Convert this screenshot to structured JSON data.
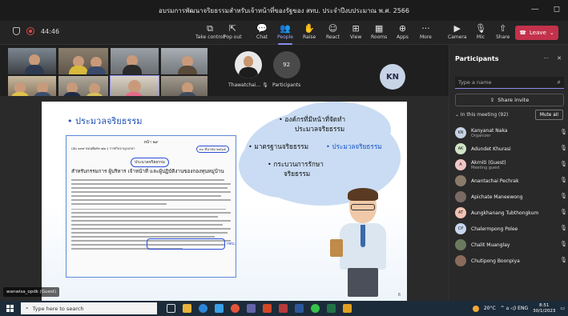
{
  "window": {
    "title": "อบรมการพัฒนาจริยธรรมสำหรับเจ้าหน้าที่ของรัฐของ สทบ. ประจำปีงบประมาณ พ.ศ. 2566",
    "minimize_glyph": "—",
    "restore_glyph": "◻"
  },
  "meeting": {
    "timer": "44:46",
    "toolbar": [
      {
        "id": "take-control",
        "label": "Take control",
        "glyph": "⧉"
      },
      {
        "id": "pop-out",
        "label": "Pop out",
        "glyph": "⇱"
      },
      {
        "id": "chat",
        "label": "Chat",
        "glyph": "💬"
      },
      {
        "id": "people",
        "label": "People",
        "glyph": "👥"
      },
      {
        "id": "raise",
        "label": "Raise",
        "glyph": "✋"
      },
      {
        "id": "react",
        "label": "React",
        "glyph": "☺"
      },
      {
        "id": "view",
        "label": "View",
        "glyph": "⊞"
      },
      {
        "id": "rooms",
        "label": "Rooms",
        "glyph": "▦"
      },
      {
        "id": "apps",
        "label": "Apps",
        "glyph": "⊕"
      },
      {
        "id": "more",
        "label": "More",
        "glyph": "···"
      },
      {
        "id": "camera",
        "label": "Camera",
        "glyph": "▶"
      },
      {
        "id": "mic",
        "label": "Mic",
        "glyph": "🎙"
      },
      {
        "id": "share",
        "label": "Share",
        "glyph": "⇧"
      }
    ],
    "leave_label": "Leave",
    "leave_glyph": "☎",
    "leave_chevron": "⌄"
  },
  "tiles": {
    "speaker_name": "Thawatchai...",
    "participants_count": "92",
    "participants_label": "Participants",
    "kn_initials": "KN"
  },
  "slide": {
    "title_bullet": "• ประมวลจริยธรรม",
    "doc_header": "หน้า  ๒๙",
    "doc_ref": "เล่ม  ๑๓๙  ตอนพิเศษ  ๗๒  ง    ราชกิจจานุเบกษา",
    "doc_date": "๓๐  มีนาคม  ๒๕๖๕",
    "doc_announce": "ประมวลจริยธรรม",
    "doc_subject": "สำหรับกรรมการ  ผู้บริหาร  เจ้าหน้าที่  และผู้ปฏิบัติงานของกองทุนหมู่บ้าน",
    "doc_side_note": "กทบ.",
    "bullets": [
      {
        "text": "• องค์กรที่มีหน้าที่จัดทำ",
        "line2": "ประมวลจริยธรรม"
      },
      {
        "text": "• มาตรฐานจริยธรรม"
      },
      {
        "text": "• ประมวลจริยธรรม"
      },
      {
        "text": "• กระบวนการรักษา",
        "line2": "จริยธรรม"
      }
    ],
    "page_number": "6",
    "presenter_tag": "wanwisa_opdk (Guest)"
  },
  "panel": {
    "title": "Participants",
    "more_glyph": "···",
    "close_glyph": "✕",
    "search_placeholder": "Type a name",
    "search_glyph": "⌕",
    "share_invite": "Share invite",
    "share_glyph": "⇪",
    "in_meeting": "⌄ In this meeting (92)",
    "mute_all": "Mute all",
    "mic_glyph": "🎙",
    "participants": [
      {
        "initials": "KN",
        "name": "Kanyanat Naka",
        "role": "Organizer",
        "color": "#c7d3e6"
      },
      {
        "initials": "AK",
        "name": "Adundet Khurasi",
        "role": "",
        "color": "#cfe6c5"
      },
      {
        "initials": "A",
        "name": "Akrniti (Guest)",
        "role": "Meeting guest",
        "color": "#f2c6c6"
      },
      {
        "initials": "",
        "name": "Anantachai Pechrak",
        "role": "",
        "color": "#8a7a6a"
      },
      {
        "initials": "",
        "name": "Apichate Maneewong",
        "role": "",
        "color": "#7a6a64"
      },
      {
        "initials": "AT",
        "name": "Aungkhanang Tubthongkum",
        "role": "",
        "color": "#f2c2b4"
      },
      {
        "initials": "CP",
        "name": "Chalermpong Polee",
        "role": "",
        "color": "#c8d6ee"
      },
      {
        "initials": "",
        "name": "Chalit Muanglay",
        "role": "",
        "color": "#6a7a60"
      },
      {
        "initials": "",
        "name": "Chutipong Boonpiya",
        "role": "",
        "color": "#8a6a5a"
      }
    ]
  },
  "taskbar": {
    "search_placeholder": "Type here to search",
    "search_glyph": "⌕",
    "weather": "20°C",
    "tray_icons": "^ ⌂ ◁) ENG",
    "time": "8:51",
    "date": "30/1/2023",
    "notify_glyph": "▭"
  }
}
